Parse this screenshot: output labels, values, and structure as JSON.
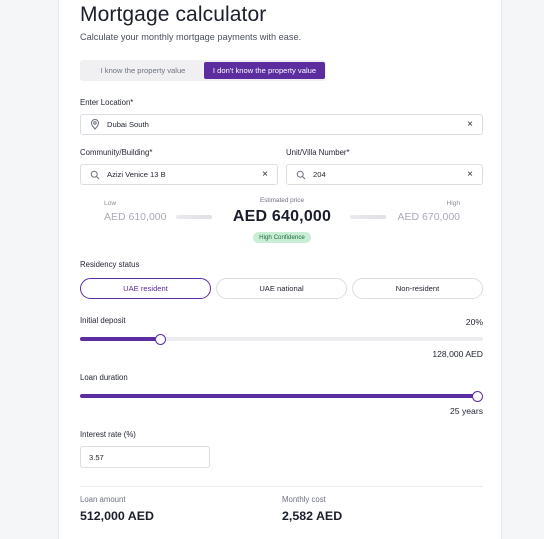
{
  "header": {
    "title": "Mortgage calculator",
    "subtitle": "Calculate your monthly mortgage payments with ease."
  },
  "mode_toggle": {
    "options": [
      "I know the property value",
      "I don't know the property value"
    ],
    "selected": "I don't know the property value"
  },
  "location": {
    "label": "Enter Location*",
    "value": "Dubai South",
    "icon": "map-pin-icon"
  },
  "community": {
    "label": "Community/Building*",
    "value": "Azizi Venice 13 B",
    "icon": "search-icon"
  },
  "unit": {
    "label": "Unit/Villa Number*",
    "value": "204",
    "icon": "search-icon"
  },
  "clear_symbol": "×",
  "estimate": {
    "low_label": "Low",
    "low_value": "AED 610,000",
    "center_label": "Estimated price",
    "price": "AED 640,000",
    "confidence": "High Confidence",
    "high_label": "High",
    "high_value": "AED 670,000"
  },
  "residency": {
    "label": "Residency status",
    "options": [
      "UAE resident",
      "UAE national",
      "Non-resident"
    ],
    "selected": "UAE resident",
    "accent_color": "#5b2d9f"
  },
  "deposit": {
    "label": "Initial deposit",
    "percent_text": "20%",
    "level_fraction": 0.2,
    "amount_text": "128,000 AED"
  },
  "duration": {
    "label": "Loan duration",
    "level_fraction": 1.0,
    "value_text": "25 years"
  },
  "interest": {
    "label": "Interest rate (%)",
    "value": "3.57"
  },
  "summary": {
    "loan_amount_label": "Loan amount",
    "loan_amount_value": "512,000 AED",
    "monthly_cost_label": "Monthly cost",
    "monthly_cost_value": "2,582 AED"
  }
}
